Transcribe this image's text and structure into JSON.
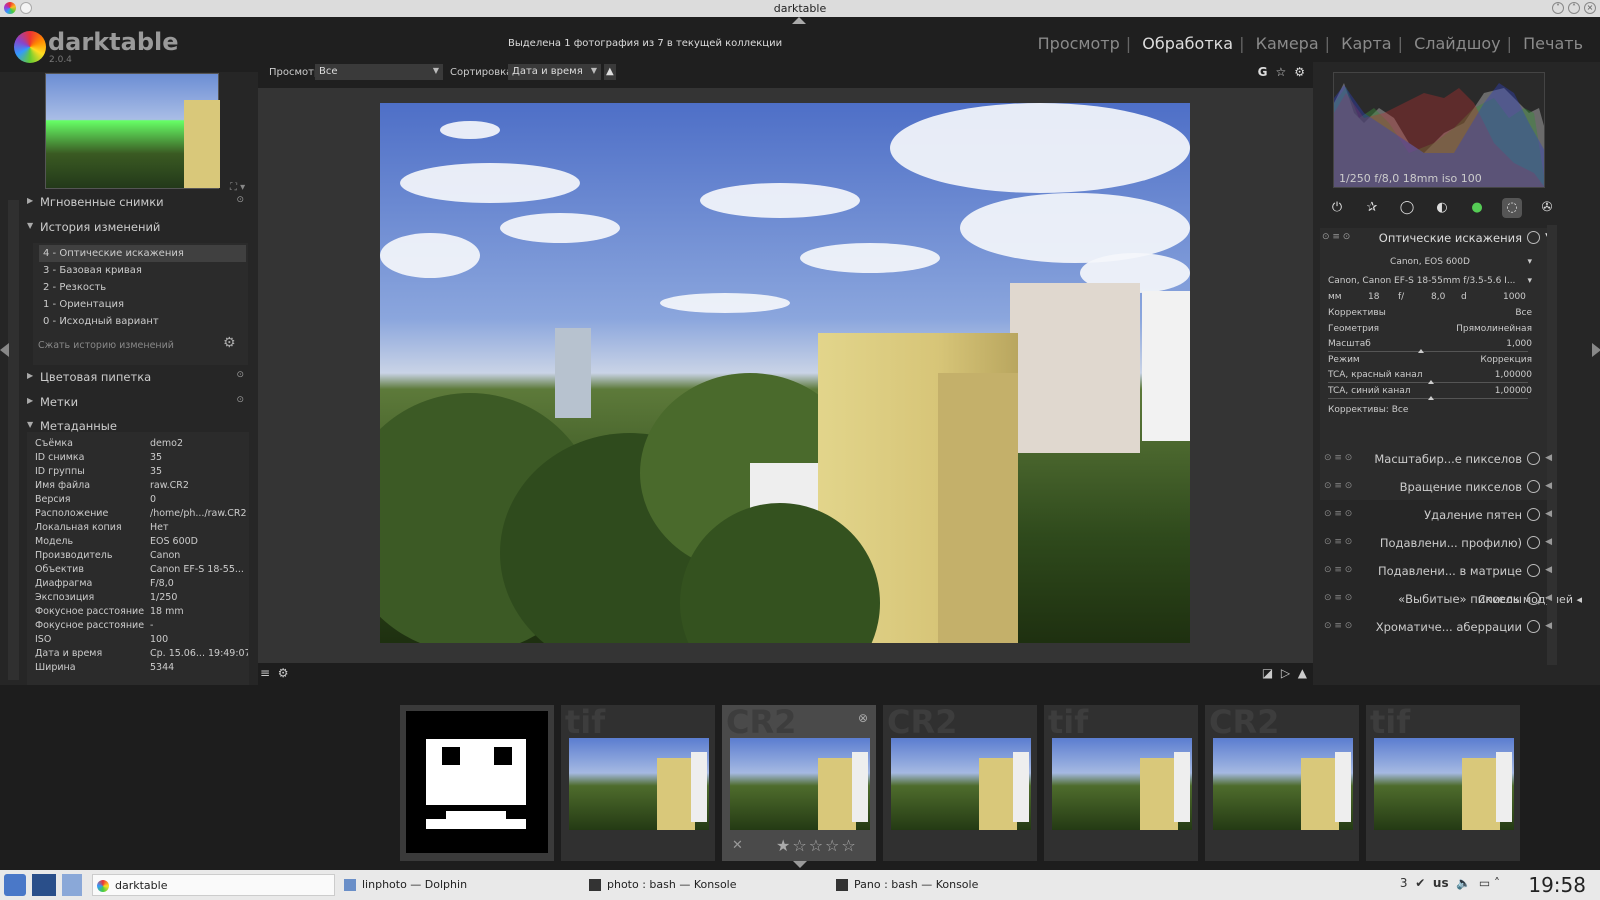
{
  "window": {
    "title": "darktable"
  },
  "app": {
    "name": "darktable",
    "version": "2.0.4"
  },
  "status_text": "Выделена 1 фотография из 7 в текущей коллекции",
  "views": [
    {
      "label": "Просмотр",
      "active": false
    },
    {
      "label": "Обработка",
      "active": true
    },
    {
      "label": "Камера",
      "active": false
    },
    {
      "label": "Карта",
      "active": false
    },
    {
      "label": "Слайдшоу",
      "active": false
    },
    {
      "label": "Печать",
      "active": false
    }
  ],
  "toolbar": {
    "view_label": "Просмотр",
    "view_value": "Все",
    "sort_label": "Сортировка",
    "sort_value": "Дата и время",
    "grouping_label": "G"
  },
  "left_panel": {
    "snapshots": "Мгновенные снимки",
    "history_title": "История изменений",
    "history_items": [
      "4 - Оптические искажения",
      "3 - Базовая кривая",
      "2 - Резкость",
      "1 - Ориентация",
      "0 - Исходный вариант"
    ],
    "history_selected": 0,
    "compress_label": "Сжать историю изменений",
    "color_picker": "Цветовая пипетка",
    "tags": "Метки",
    "metadata_title": "Метаданные",
    "metadata": [
      {
        "k": "Съёмка",
        "v": "demo2"
      },
      {
        "k": "ID снимка",
        "v": "35"
      },
      {
        "k": "ID группы",
        "v": "35"
      },
      {
        "k": "Имя файла",
        "v": "raw.CR2"
      },
      {
        "k": "Версия",
        "v": "0"
      },
      {
        "k": "Расположение",
        "v": "/home/ph.../raw.CR2"
      },
      {
        "k": "Локальная копия",
        "v": "Нет"
      },
      {
        "k": "Модель",
        "v": "EOS 600D"
      },
      {
        "k": "Производитель",
        "v": "Canon"
      },
      {
        "k": "Объектив",
        "v": "Canon EF-S 18-55..."
      },
      {
        "k": "Диафрагма",
        "v": "F/8,0"
      },
      {
        "k": "Экспозиция",
        "v": "1/250"
      },
      {
        "k": "Фокусное расстояние",
        "v": "18 mm"
      },
      {
        "k": "Фокусное расстояние",
        "v": "-"
      },
      {
        "k": "ISO",
        "v": "100"
      },
      {
        "k": "Дата и время",
        "v": "Ср. 15.06... 19:49:07"
      },
      {
        "k": "Ширина",
        "v": "5344"
      }
    ]
  },
  "right_panel": {
    "histogram_info": "1/250 f/8,0 18mm iso 100",
    "active_module": {
      "title": "Оптические искажения",
      "camera": "Canon, EOS 600D",
      "lens": "Canon, Canon EF-S 18-55mm f/3.5-5.6 I...",
      "mm_label": "мм",
      "mm_value": "18",
      "f_label": "f/",
      "f_value": "8,0",
      "d_label": "d",
      "d_value": "1000",
      "rows": [
        {
          "k": "Коррективы",
          "v": "Все"
        },
        {
          "k": "Геометрия",
          "v": "Прямолинейная"
        },
        {
          "k": "Масштаб",
          "v": "1,000"
        },
        {
          "k": "Режим",
          "v": "Коррекция"
        },
        {
          "k": "TCA, красный канал",
          "v": "1,00000"
        },
        {
          "k": "TCA, синий канал",
          "v": "1,00000"
        }
      ],
      "corrections": "Коррективы: Все"
    },
    "modules": [
      "Масштабир...е пикселов",
      "Вращение пикселов",
      "Удаление пятен",
      "Подавлени... профилю)",
      "Подавлени... в матрице",
      "«Выбитые» пикселы",
      "Хроматиче... аберрации"
    ],
    "module_list_label": "Список модулей"
  },
  "filmstrip": {
    "thumbs": [
      {
        "ext": "",
        "selected": false
      },
      {
        "ext": "tif",
        "selected": false
      },
      {
        "ext": "CR2",
        "selected": true
      },
      {
        "ext": "CR2",
        "selected": false
      },
      {
        "ext": "tif",
        "selected": false
      },
      {
        "ext": "CR2",
        "selected": false
      },
      {
        "ext": "tif",
        "selected": false
      }
    ],
    "rating": 1
  },
  "taskbar": {
    "tasks": [
      "darktable",
      "linphoto — Dolphin",
      "photo : bash — Konsole",
      "Pano : bash — Konsole"
    ],
    "tray_count": "3",
    "keyboard": "us",
    "clock": "19:58"
  },
  "colors": {
    "accent": "#dddddd",
    "panel": "#262626",
    "center": "#343434"
  }
}
